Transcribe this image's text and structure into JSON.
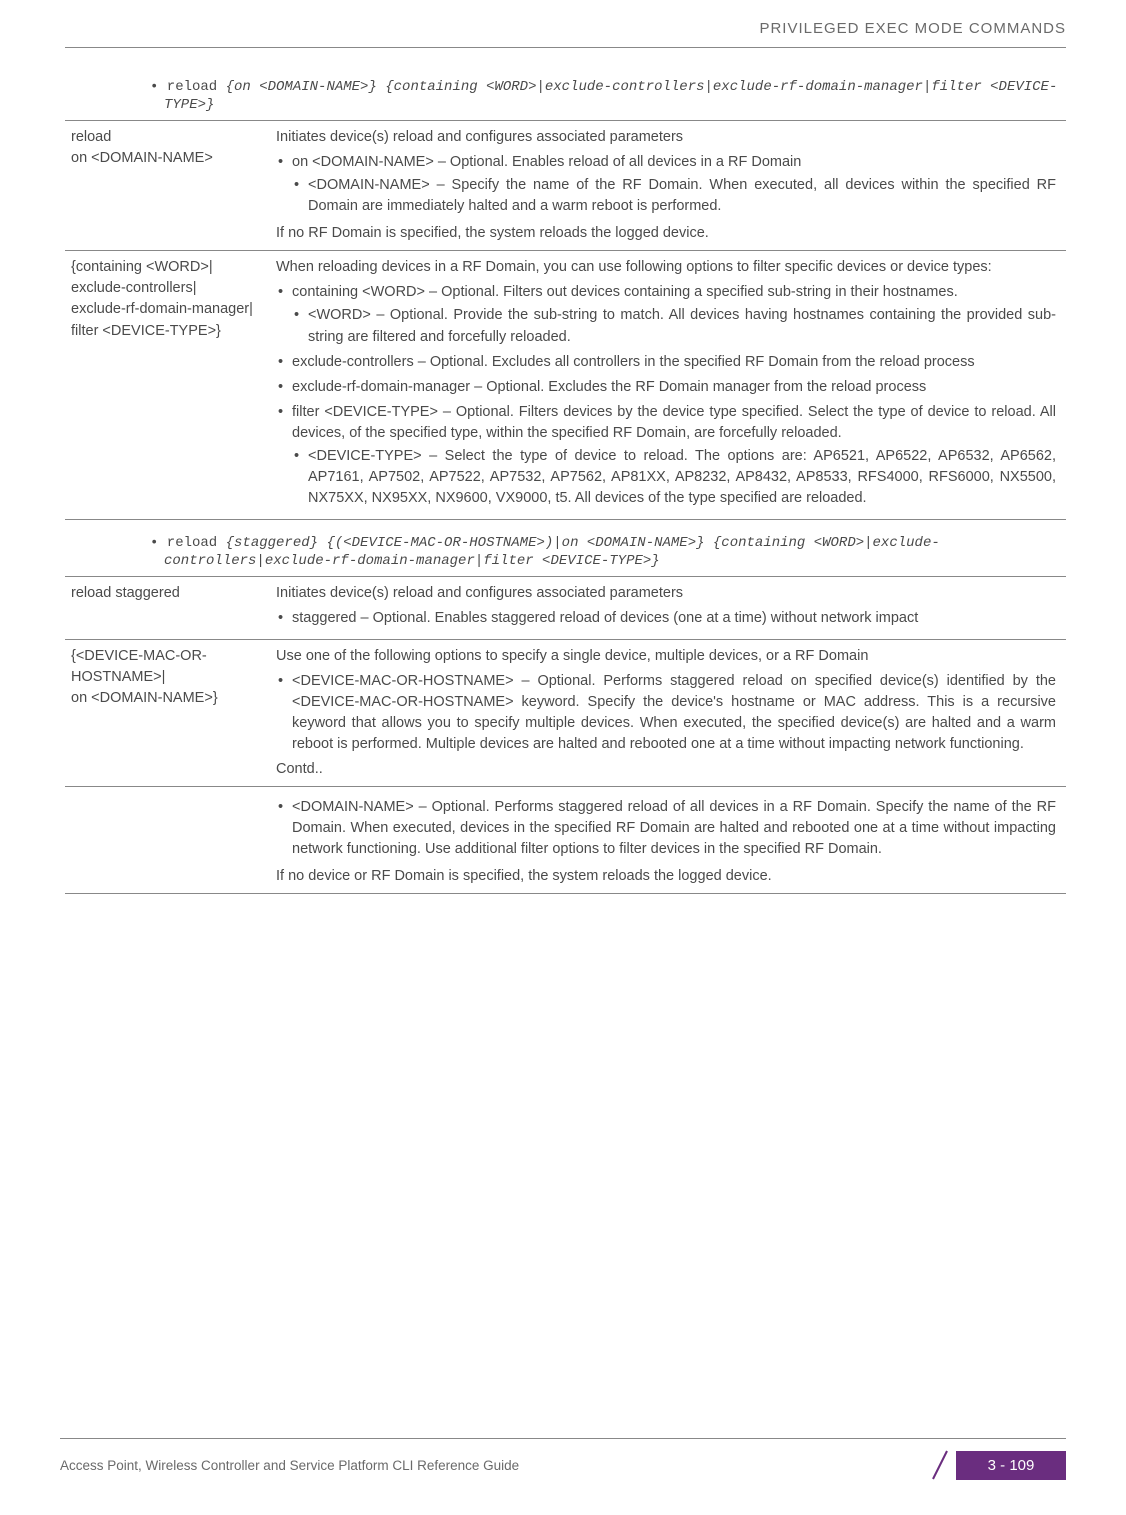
{
  "header": {
    "title": "PRIVILEGED EXEC MODE COMMANDS"
  },
  "code1": {
    "prefix": "• reload ",
    "italic": "{on <DOMAIN-NAME>} {containing <WORD>|exclude-controllers|exclude-rf-domain-manager|filter <DEVICE-TYPE>}"
  },
  "table1": {
    "row1": {
      "left": "reload\non <DOMAIN-NAME>",
      "intro": "Initiates device(s) reload and configures associated parameters",
      "b1": "on <DOMAIN-NAME> – Optional. Enables reload of all devices in a RF Domain",
      "s1": "<DOMAIN-NAME> – Specify the name of the RF Domain. When executed, all devices within the specified RF Domain are immediately halted and a warm reboot is performed.",
      "note": "If no RF Domain is specified, the system reloads the logged device."
    },
    "row2": {
      "left": "{containing <WORD>|\nexclude-controllers|\nexclude-rf-domain-manager|\nfilter <DEVICE-TYPE>}",
      "intro": "When reloading devices in a RF Domain, you can use following options to filter specific devices or device types:",
      "b1": "containing <WORD> – Optional. Filters out devices containing a specified sub-string in their hostnames.",
      "s1": "<WORD> – Optional. Provide the sub-string to match. All devices having hostnames containing the provided sub-string are filtered and forcefully reloaded.",
      "b2": "exclude-controllers – Optional. Excludes all controllers in the specified RF Domain from the reload process",
      "b3": "exclude-rf-domain-manager – Optional. Excludes the RF Domain manager from the reload process",
      "b4": "filter <DEVICE-TYPE> – Optional. Filters devices by the device type specified. Select the type of device to reload. All devices, of the specified type, within the specified RF Domain, are forcefully reloaded.",
      "s4": "<DEVICE-TYPE> – Select the type of device to reload. The options are: AP6521, AP6522, AP6532, AP6562, AP7161, AP7502, AP7522, AP7532, AP7562, AP81XX, AP8232, AP8432, AP8533, RFS4000, RFS6000, NX5500, NX75XX, NX95XX, NX9600, VX9000, t5. All devices of the type specified are reloaded."
    }
  },
  "code2": {
    "prefix": "• reload ",
    "italic": "{staggered} {(<DEVICE-MAC-OR-HOSTNAME>)|on <DOMAIN-NAME>} {containing <WORD>|exclude-controllers|exclude-rf-domain-manager|filter <DEVICE-TYPE>}"
  },
  "table2": {
    "row1": {
      "left": "reload staggered",
      "intro": "Initiates device(s) reload and configures associated parameters",
      "b1": "staggered – Optional. Enables staggered reload of devices (one at a time) without network impact"
    },
    "row2": {
      "left": "{<DEVICE-MAC-OR-HOSTNAME>|\non <DOMAIN-NAME>}",
      "intro": "Use one of the following options to specify a single device, multiple devices, or a RF Domain",
      "b1": "<DEVICE-MAC-OR-HOSTNAME> – Optional. Performs staggered reload on specified device(s) identified by the <DEVICE-MAC-OR-HOSTNAME> keyword. Specify the device's hostname or MAC address. This is a recursive keyword that allows you to specify multiple devices. When executed, the specified device(s) are halted and a warm reboot is performed. Multiple devices are halted and rebooted one at a time without impacting network functioning.",
      "contd": "Contd.."
    },
    "row3": {
      "b1": "<DOMAIN-NAME> – Optional. Performs staggered reload of all devices in a RF Domain. Specify the name of the RF Domain. When executed, devices in the specified RF Domain are halted and rebooted one at a time without impacting network functioning. Use additional filter options to filter devices in the specified RF Domain.",
      "note": "If no device or RF Domain is specified, the system reloads the logged device."
    }
  },
  "footer": {
    "text": "Access Point, Wireless Controller and Service Platform CLI Reference Guide",
    "page": "3 - 109"
  }
}
